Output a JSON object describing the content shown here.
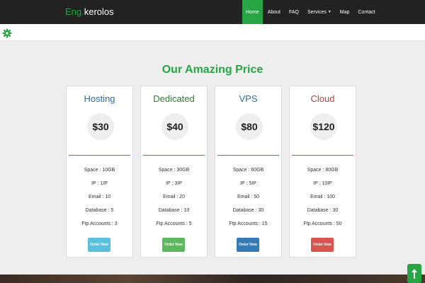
{
  "brand": {
    "prefix": "Eng.",
    "name": "kerolos"
  },
  "nav": [
    {
      "label": "Home",
      "active": true
    },
    {
      "label": "About",
      "active": false
    },
    {
      "label": "FAQ",
      "active": false
    },
    {
      "label": "Services",
      "active": false,
      "dropdown": true
    },
    {
      "label": "Map",
      "active": false
    },
    {
      "label": "Contact",
      "active": false
    }
  ],
  "section_title": "Our Amazing Price",
  "plans": [
    {
      "name": "Hosting",
      "price": "$30",
      "features": [
        "Space : 10GB",
        "IP : 1IP",
        "Email : 10",
        "Database : 5",
        "Ftp Accounts : 3"
      ],
      "button": "Order Now",
      "title_color": "#2e6da4",
      "button_color": "#5bc0de"
    },
    {
      "name": "Dedicated",
      "price": "$40",
      "features": [
        "Space : 30GB",
        "IP : 3IP",
        "Email : 20",
        "Database : 10",
        "Ftp Accounts : 5"
      ],
      "button": "Order Now",
      "title_color": "#2e7d32",
      "button_color": "#5cb85c"
    },
    {
      "name": "VPS",
      "price": "$80",
      "features": [
        "Space : 60GB",
        "IP : 5IP",
        "Email : 50",
        "Database : 30",
        "Ftp Accounts : 15"
      ],
      "button": "Order Now",
      "title_color": "#2e6da4",
      "button_color": "#337ab7"
    },
    {
      "name": "Cloud",
      "price": "$120",
      "features": [
        "Space : 80GB",
        "IP : 10IP",
        "Email : 100",
        "Database : 30",
        "Ftp Accounts : 50"
      ],
      "button": "Order Now",
      "title_color": "#a94442",
      "button_color": "#d9534f"
    }
  ],
  "icons": {
    "settings": "gear-icon",
    "scroll_top": "arrow-up-icon"
  },
  "colors": {
    "accent": "#27a544",
    "navbar": "#222222",
    "background": "#eeeeee"
  }
}
